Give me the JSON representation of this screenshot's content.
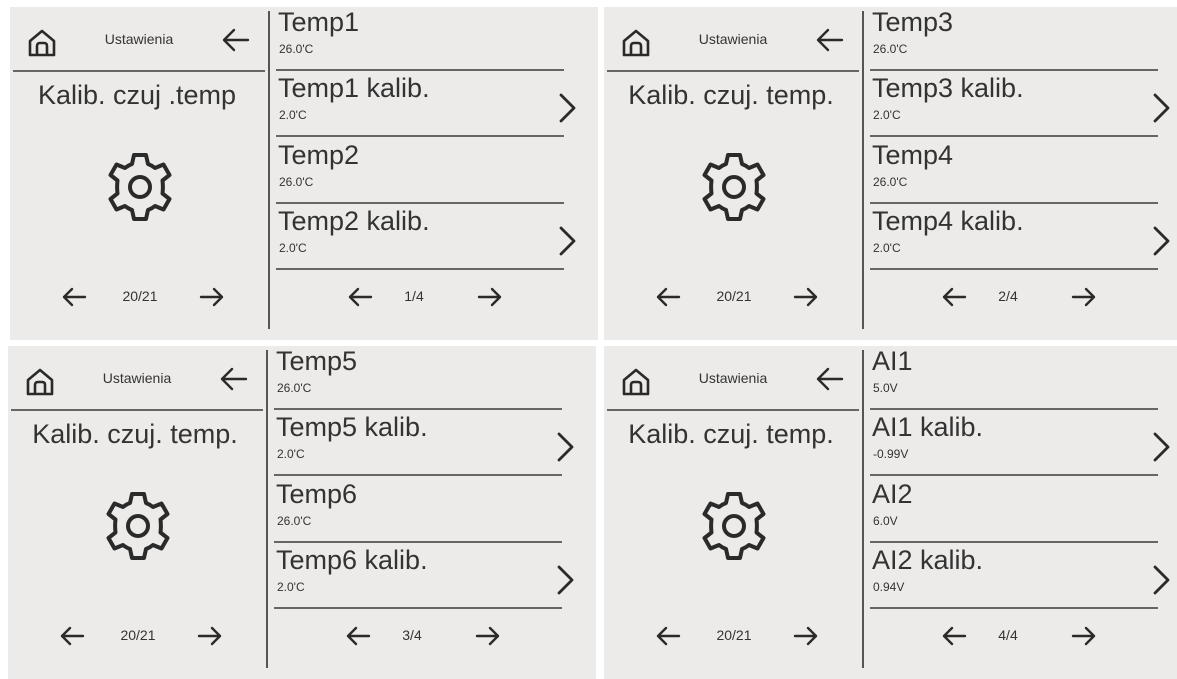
{
  "panels": [
    {
      "header_title": "Ustawienia",
      "screen_title": "Kalib. czuj .temp",
      "left_pager": "20/21",
      "rows": [
        {
          "label": "Temp1",
          "value": "26.0'C",
          "has_chevron": false
        },
        {
          "label": "Temp1 kalib.",
          "value": "2.0'C",
          "has_chevron": true
        },
        {
          "label": "Temp2",
          "value": "26.0'C",
          "has_chevron": false
        },
        {
          "label": "Temp2 kalib.",
          "value": "2.0'C",
          "has_chevron": true
        }
      ],
      "right_pager": "1/4"
    },
    {
      "header_title": "Ustawienia",
      "screen_title": "Kalib. czuj. temp.",
      "left_pager": "20/21",
      "rows": [
        {
          "label": "Temp3",
          "value": "26.0'C",
          "has_chevron": false
        },
        {
          "label": "Temp3 kalib.",
          "value": "2.0'C",
          "has_chevron": true
        },
        {
          "label": "Temp4",
          "value": "26.0'C",
          "has_chevron": false
        },
        {
          "label": "Temp4 kalib.",
          "value": "2.0'C",
          "has_chevron": true
        }
      ],
      "right_pager": "2/4"
    },
    {
      "header_title": "Ustawienia",
      "screen_title": "Kalib. czuj. temp.",
      "left_pager": "20/21",
      "rows": [
        {
          "label": "Temp5",
          "value": "26.0'C",
          "has_chevron": false
        },
        {
          "label": "Temp5 kalib.",
          "value": "2.0'C",
          "has_chevron": true
        },
        {
          "label": "Temp6",
          "value": "26.0'C",
          "has_chevron": false
        },
        {
          "label": "Temp6 kalib.",
          "value": "2.0'C",
          "has_chevron": true
        }
      ],
      "right_pager": "3/4"
    },
    {
      "header_title": "Ustawienia",
      "screen_title": "Kalib. czuj. temp.",
      "left_pager": "20/21",
      "rows": [
        {
          "label": "AI1",
          "value": "5.0V",
          "has_chevron": false
        },
        {
          "label": "AI1 kalib.",
          "value": "-0.99V",
          "has_chevron": true
        },
        {
          "label": "AI2",
          "value": "6.0V",
          "has_chevron": false
        },
        {
          "label": "AI2 kalib.",
          "value": "0.94V",
          "has_chevron": true
        }
      ],
      "right_pager": "4/4"
    }
  ],
  "icons": {
    "home": "home-icon",
    "back": "arrow-left-icon",
    "settings": "gear-icon",
    "prev": "arrow-left-icon",
    "next": "arrow-right-icon",
    "open": "chevron-right-icon"
  },
  "colors": {
    "panel_background": "#ecebe9",
    "text": "#333333",
    "divider": "#666666"
  }
}
